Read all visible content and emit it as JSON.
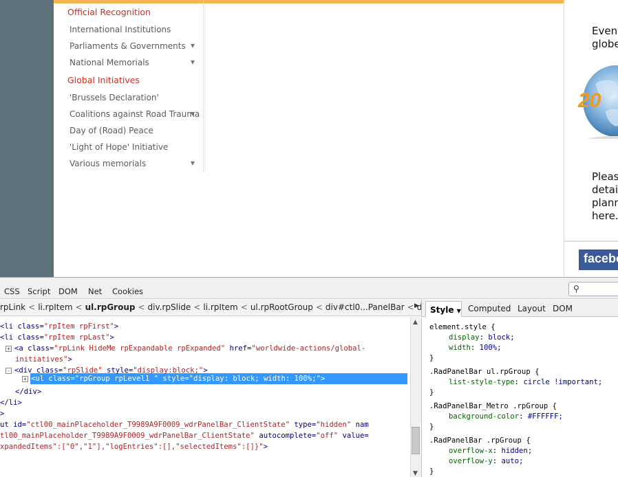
{
  "website": {
    "nav": [
      {
        "label": "Official Recognition",
        "type": "heading",
        "expandable": false
      },
      {
        "label": "International Institutions",
        "type": "item",
        "expandable": false
      },
      {
        "label": "Parliaments & Governments",
        "type": "item",
        "expandable": true
      },
      {
        "label": "National Memorials",
        "type": "item",
        "expandable": true
      },
      {
        "label": "Global Initiatives",
        "type": "heading",
        "expandable": false
      },
      {
        "label": "'Brussels Declaration'",
        "type": "item",
        "expandable": false
      },
      {
        "label": "Coalitions against Road Trauma",
        "type": "item",
        "expandable": true
      },
      {
        "label": "Day of (Road) Peace",
        "type": "item",
        "expandable": false
      },
      {
        "label": "'Light of Hope' Initiative",
        "type": "item",
        "expandable": false
      },
      {
        "label": "Various memorials",
        "type": "item",
        "expandable": true
      }
    ],
    "right_col": {
      "event_text": [
        "Event",
        "globe"
      ],
      "globe_label": "20",
      "please_text": [
        "Pleas",
        "detail",
        "planne",
        "here."
      ],
      "facebook": "facebo"
    },
    "colors": {
      "accent": "#f6b552",
      "heading": "#d42b1e",
      "gutter": "#5c7179",
      "facebook": "#3b5998"
    }
  },
  "firebug": {
    "tabs": [
      "CSS",
      "Script",
      "DOM",
      "Net",
      "Cookies"
    ],
    "breadcrumbs": [
      "rpLink",
      "li.rpItem",
      "ul.rpGroup",
      "div.rpSlide",
      "li.rpItem",
      "ul.rpRootGroup",
      "div#ctl0...PanelBar",
      "div#m"
    ],
    "selected_crumb": "ul.rpGroup",
    "html_lines": [
      {
        "parts": [
          [
            "tag",
            "<li "
          ],
          [
            "attr",
            "class="
          ],
          [
            "val",
            "\"rpItem rpFirst\""
          ],
          [
            "tag",
            ">"
          ]
        ]
      },
      {
        "parts": [
          [
            "tag",
            "<li "
          ],
          [
            "attr",
            "class="
          ],
          [
            "val",
            "\"rpItem rpLast\""
          ],
          [
            "tag",
            ">"
          ]
        ]
      },
      {
        "expander": "+",
        "parts": [
          [
            "tag",
            "<a "
          ],
          [
            "attr",
            "class="
          ],
          [
            "val",
            "\"rpLink HideMe rpExpandable rpExpanded\""
          ],
          [
            "attr",
            " href="
          ],
          [
            "val",
            "\"worldwide-actions/global-"
          ]
        ]
      },
      {
        "parts": [
          [
            "val",
            "initiatives\""
          ],
          [
            "tag",
            ">"
          ]
        ]
      },
      {
        "expander": "-",
        "parts": [
          [
            "tag",
            "<div "
          ],
          [
            "attr",
            "class="
          ],
          [
            "val",
            "\"rpSlide\""
          ],
          [
            "attr",
            " style="
          ],
          [
            "val",
            "\"display:block;\""
          ],
          [
            "tag",
            ">"
          ]
        ]
      },
      {
        "expander": "+",
        "selected": true,
        "text": "<ul class=\"rpGroup rpLevel1 \" style=\"display: block; width: 100%;\">"
      },
      {
        "parts": [
          [
            "tag",
            "</div>"
          ]
        ]
      },
      {
        "parts": [
          [
            "tag",
            "</li>"
          ]
        ]
      },
      {
        "parts": [
          [
            "tag",
            ">"
          ]
        ]
      },
      {
        "parts": [
          [
            "attr",
            "ut id="
          ],
          [
            "val",
            "\"ctl00_mainPlaceholder_T9989A9F0009_wdrPanelBar_ClientState\""
          ],
          [
            "attr",
            " type="
          ],
          [
            "val",
            "\"hidden\""
          ],
          [
            "attr",
            " nam"
          ]
        ]
      },
      {
        "parts": [
          [
            "val",
            "tl00_mainPlaceholder_T9989A9F0009_wdrPanelBar_ClientState\""
          ],
          [
            "attr",
            " autocomplete="
          ],
          [
            "val",
            "\"off\""
          ],
          [
            "attr",
            " value="
          ]
        ]
      },
      {
        "parts": [
          [
            "val",
            "xpandedItems\":[\"0\",\"1\"],\"logEntries\":[],\"selectedItems\":[]}\""
          ],
          [
            "tag",
            ">"
          ]
        ]
      }
    ],
    "side_tabs": {
      "style": "Style",
      "computed": "Computed",
      "layout": "Layout",
      "dom": "DOM"
    },
    "css_rules": [
      {
        "selector": "element.style {",
        "props": [
          [
            "display",
            "block;"
          ],
          [
            "width",
            "100%;"
          ]
        ]
      },
      {
        "selector": ".RadPanelBar ul.rpGroup {",
        "props": [
          [
            "list-style-type",
            "circle !important;"
          ]
        ]
      },
      {
        "selector": ".RadPanelBar_Metro .rpGroup {",
        "props": [
          [
            "background-color",
            "#FFFFFF;"
          ]
        ]
      },
      {
        "selector": ".RadPanelBar .rpGroup {",
        "props": [
          [
            "overflow-x",
            "hidden;"
          ],
          [
            "overflow-y",
            "auto;"
          ]
        ]
      }
    ]
  }
}
